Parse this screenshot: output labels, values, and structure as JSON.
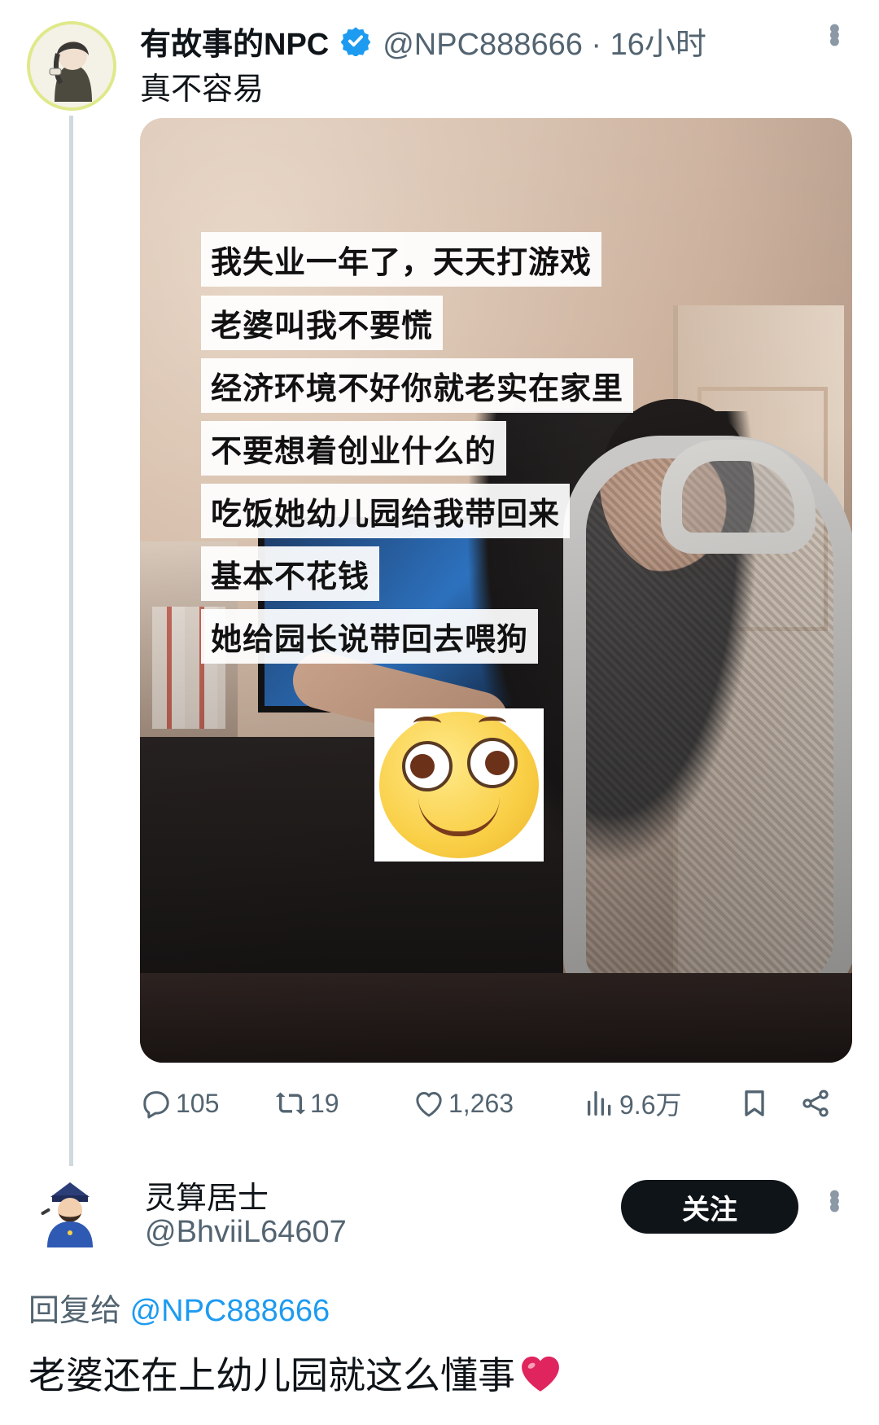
{
  "tweet": {
    "author_name": "有故事的NPC",
    "author_handle_time": "@NPC888666 · 16小时",
    "text": "真不容易",
    "media_captions": [
      "我失业一年了，天天打游戏",
      "老婆叫我不要慌",
      "经济环境不好你就老实在家里",
      "不要想着创业什么的",
      "吃饭她幼儿园给我带回来",
      "基本不花钱",
      "她给园长说带回去喂狗"
    ],
    "stats": {
      "replies": "105",
      "retweets": "19",
      "likes": "1,263",
      "views": "9.6万"
    },
    "verified_color": "#1d9bf0"
  },
  "reply": {
    "author_name": "灵算居士",
    "author_handle": "@BhviiL64607",
    "follow_label": "关注",
    "reply_to_prefix": "回复给 ",
    "reply_to_handle": "@NPC888666",
    "text": "老婆还在上幼儿园就这么懂事",
    "meta_text": "",
    "meta_views": ""
  },
  "colors": {
    "accent": "#1d9bf0",
    "text_primary": "#0f1419",
    "text_secondary": "#536471",
    "heart": "#e0245e"
  }
}
